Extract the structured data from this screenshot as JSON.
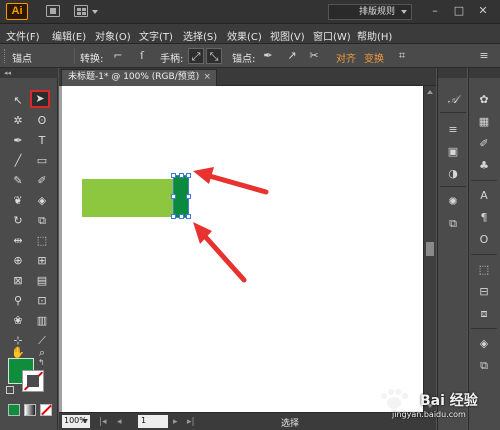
{
  "titlebar": {
    "app_logo": "Ai",
    "workspace": "排版规则",
    "controls": [
      "–",
      "□",
      "✕"
    ]
  },
  "menu": [
    "文件(F)",
    "编辑(E)",
    "对象(O)",
    "文字(T)",
    "选择(S)",
    "效果(C)",
    "视图(V)",
    "窗口(W)",
    "帮助(H)"
  ],
  "control_bar": {
    "selection_label": "锚点",
    "convert_label": "转换:",
    "handles_label": "手柄:",
    "anchor_label": "锚点:",
    "align_label": "对齐",
    "transform_label": "变换"
  },
  "document": {
    "tab_title": "未标题-1* @ 100% (RGB/预览)",
    "tab_close": "×"
  },
  "statusbar": {
    "zoom": "100%",
    "page": "1",
    "status": "选择"
  },
  "swatches": {
    "fill_color": "#0e8e3c",
    "stroke": "none"
  },
  "artwork": {
    "light_rect_color": "#8dc63f",
    "dark_rect_color": "#0a8a3c",
    "selection_color": "#3d7cd8"
  },
  "annotation": {
    "arrow_color": "#e8322f"
  },
  "watermark": {
    "brand": "Bai 经验",
    "url": "jingyan.baidu.com"
  }
}
